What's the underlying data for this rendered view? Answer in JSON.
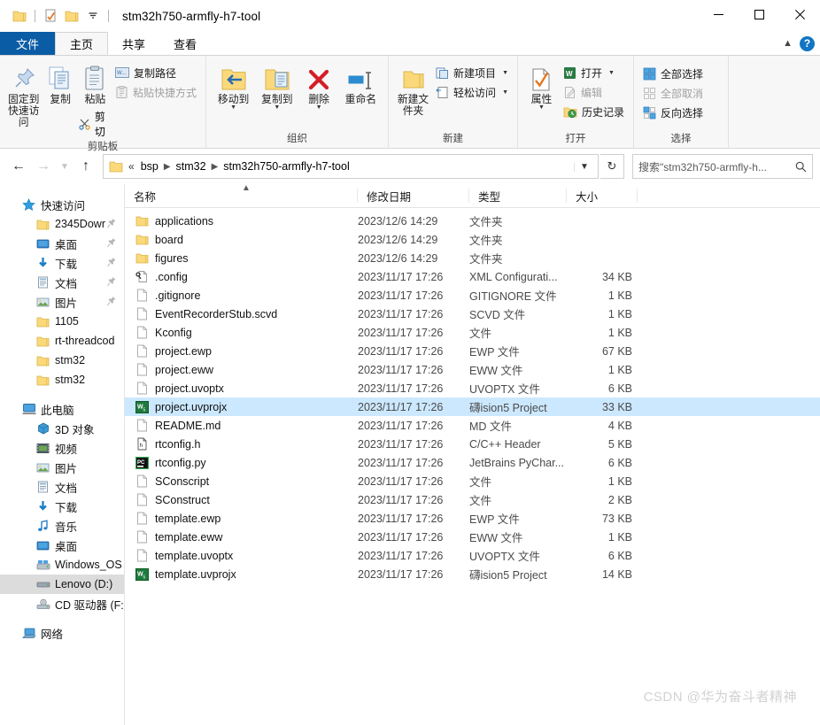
{
  "window": {
    "title": "stm32h750-armfly-h7-tool",
    "quick_access": [
      "folder-icon",
      "properties-checked-icon",
      "new-folder-icon",
      "dropdown-icon"
    ],
    "controls": {
      "minimize": "—",
      "maximize": "□",
      "close": "✕"
    }
  },
  "ribbon": {
    "tabs": [
      {
        "label": "文件",
        "type": "file"
      },
      {
        "label": "主页",
        "type": "active"
      },
      {
        "label": "共享",
        "type": "normal"
      },
      {
        "label": "查看",
        "type": "normal"
      }
    ],
    "collapse_icon": "chevron-up-icon",
    "help_icon": "?",
    "groups": [
      {
        "title": "剪贴板",
        "big": [
          {
            "label": "固定到快速访问",
            "icon": "pin-icon",
            "disabled": false
          },
          {
            "label": "复制",
            "icon": "copy-icon",
            "disabled": false
          },
          {
            "label": "粘贴",
            "icon": "paste-icon",
            "disabled": false
          }
        ],
        "small": [
          {
            "label": "复制路径",
            "icon": "copy-path-icon",
            "disabled": false
          },
          {
            "label": "粘贴快捷方式",
            "icon": "paste-shortcut-icon",
            "disabled": true
          }
        ],
        "extra_small": [
          {
            "label": "剪切",
            "icon": "scissors-icon",
            "disabled": false
          }
        ]
      },
      {
        "title": "组织",
        "big": [
          {
            "label": "移动到",
            "icon": "move-to-icon",
            "caret": true
          },
          {
            "label": "复制到",
            "icon": "copy-to-icon",
            "caret": true
          },
          {
            "label": "删除",
            "icon": "delete-icon",
            "caret": true
          },
          {
            "label": "重命名",
            "icon": "rename-icon",
            "caret": false
          }
        ]
      },
      {
        "title": "新建",
        "big": [
          {
            "label": "新建文件夹",
            "icon": "new-folder-icon"
          }
        ],
        "small": [
          {
            "label": "新建项目",
            "icon": "new-item-icon",
            "caret": true
          },
          {
            "label": "轻松访问",
            "icon": "easy-access-icon",
            "caret": true
          }
        ]
      },
      {
        "title": "打开",
        "big": [
          {
            "label": "属性",
            "icon": "properties-icon",
            "caret": true
          }
        ],
        "small": [
          {
            "label": "打开",
            "icon": "open-icon",
            "caret": true,
            "disabled": false
          },
          {
            "label": "编辑",
            "icon": "edit-icon",
            "disabled": true
          },
          {
            "label": "历史记录",
            "icon": "history-icon",
            "disabled": false
          }
        ]
      },
      {
        "title": "选择",
        "small": [
          {
            "label": "全部选择",
            "icon": "select-all-icon",
            "disabled": false
          },
          {
            "label": "全部取消",
            "icon": "select-none-icon",
            "disabled": true
          },
          {
            "label": "反向选择",
            "icon": "invert-selection-icon",
            "disabled": false
          }
        ]
      }
    ]
  },
  "address": {
    "back_icon": "back-arrow-icon",
    "forward_icon": "forward-arrow-icon",
    "recent_icon": "chevron-down-icon",
    "up_icon": "up-arrow-icon",
    "breadcrumb": [
      "«",
      "bsp",
      "stm32",
      "stm32h750-armfly-h7-tool"
    ],
    "refresh_icon": "refresh-icon",
    "search_placeholder": "搜索\"stm32h750-armfly-h...",
    "search_icon": "search-icon"
  },
  "navpane": {
    "sections": [
      {
        "root": {
          "label": "快速访问",
          "icon": "star-icon"
        },
        "items": [
          {
            "label": "2345Dowr",
            "icon": "folder-icon",
            "pinned": true
          },
          {
            "label": "桌面",
            "icon": "desktop-icon",
            "pinned": true
          },
          {
            "label": "下载",
            "icon": "download-icon",
            "pinned": true
          },
          {
            "label": "文档",
            "icon": "documents-icon",
            "pinned": true
          },
          {
            "label": "图片",
            "icon": "pictures-icon",
            "pinned": true
          },
          {
            "label": "1105",
            "icon": "folder-icon",
            "pinned": false
          },
          {
            "label": "rt-threadcod",
            "icon": "folder-icon",
            "pinned": false
          },
          {
            "label": "stm32",
            "icon": "folder-icon",
            "pinned": false
          },
          {
            "label": "stm32",
            "icon": "folder-icon",
            "pinned": false
          }
        ]
      },
      {
        "root": {
          "label": "此电脑",
          "icon": "computer-icon"
        },
        "items": [
          {
            "label": "3D 对象",
            "icon": "3d-objects-icon"
          },
          {
            "label": "视频",
            "icon": "videos-icon"
          },
          {
            "label": "图片",
            "icon": "pictures-icon"
          },
          {
            "label": "文档",
            "icon": "documents-icon"
          },
          {
            "label": "下载",
            "icon": "download-icon"
          },
          {
            "label": "音乐",
            "icon": "music-icon"
          },
          {
            "label": "桌面",
            "icon": "desktop-icon"
          },
          {
            "label": "Windows_OS",
            "icon": "drive-icon"
          },
          {
            "label": "Lenovo (D:)",
            "icon": "drive-icon",
            "selected": true
          },
          {
            "label": "CD 驱动器 (F:",
            "icon": "cd-drive-icon"
          }
        ]
      },
      {
        "root": {
          "label": "网络",
          "icon": "network-icon"
        },
        "items": []
      }
    ]
  },
  "filelist": {
    "columns": [
      {
        "label": "名称",
        "key": "name",
        "sorted": "asc"
      },
      {
        "label": "修改日期",
        "key": "date"
      },
      {
        "label": "类型",
        "key": "type"
      },
      {
        "label": "大小",
        "key": "size"
      }
    ],
    "rows": [
      {
        "name": "applications",
        "date": "2023/12/6 14:29",
        "type": "文件夹",
        "size": "",
        "icon": "folder-icon",
        "selected": false
      },
      {
        "name": "board",
        "date": "2023/12/6 14:29",
        "type": "文件夹",
        "size": "",
        "icon": "folder-icon",
        "selected": false
      },
      {
        "name": "figures",
        "date": "2023/12/6 14:29",
        "type": "文件夹",
        "size": "",
        "icon": "folder-icon",
        "selected": false
      },
      {
        "name": ".config",
        "date": "2023/11/17 17:26",
        "type": "XML Configurati...",
        "size": "34 KB",
        "icon": "config-file-icon",
        "selected": false
      },
      {
        "name": ".gitignore",
        "date": "2023/11/17 17:26",
        "type": "GITIGNORE 文件",
        "size": "1 KB",
        "icon": "blank-file-icon",
        "selected": false
      },
      {
        "name": "EventRecorderStub.scvd",
        "date": "2023/11/17 17:26",
        "type": "SCVD 文件",
        "size": "1 KB",
        "icon": "blank-file-icon",
        "selected": false
      },
      {
        "name": "Kconfig",
        "date": "2023/11/17 17:26",
        "type": "文件",
        "size": "1 KB",
        "icon": "blank-file-icon",
        "selected": false
      },
      {
        "name": "project.ewp",
        "date": "2023/11/17 17:26",
        "type": "EWP 文件",
        "size": "67 KB",
        "icon": "blank-file-icon",
        "selected": false
      },
      {
        "name": "project.eww",
        "date": "2023/11/17 17:26",
        "type": "EWW 文件",
        "size": "1 KB",
        "icon": "blank-file-icon",
        "selected": false
      },
      {
        "name": "project.uvoptx",
        "date": "2023/11/17 17:26",
        "type": "UVOPTX 文件",
        "size": "6 KB",
        "icon": "blank-file-icon",
        "selected": false
      },
      {
        "name": "project.uvprojx",
        "date": "2023/11/17 17:26",
        "type": "礴ision5 Project",
        "size": "33 KB",
        "icon": "keil-icon",
        "selected": true
      },
      {
        "name": "README.md",
        "date": "2023/11/17 17:26",
        "type": "MD 文件",
        "size": "4 KB",
        "icon": "blank-file-icon",
        "selected": false
      },
      {
        "name": "rtconfig.h",
        "date": "2023/11/17 17:26",
        "type": "C/C++ Header",
        "size": "5 KB",
        "icon": "header-file-icon",
        "selected": false
      },
      {
        "name": "rtconfig.py",
        "date": "2023/11/17 17:26",
        "type": "JetBrains PyChar...",
        "size": "6 KB",
        "icon": "pycharm-icon",
        "selected": false
      },
      {
        "name": "SConscript",
        "date": "2023/11/17 17:26",
        "type": "文件",
        "size": "1 KB",
        "icon": "blank-file-icon",
        "selected": false
      },
      {
        "name": "SConstruct",
        "date": "2023/11/17 17:26",
        "type": "文件",
        "size": "2 KB",
        "icon": "blank-file-icon",
        "selected": false
      },
      {
        "name": "template.ewp",
        "date": "2023/11/17 17:26",
        "type": "EWP 文件",
        "size": "73 KB",
        "icon": "blank-file-icon",
        "selected": false
      },
      {
        "name": "template.eww",
        "date": "2023/11/17 17:26",
        "type": "EWW 文件",
        "size": "1 KB",
        "icon": "blank-file-icon",
        "selected": false
      },
      {
        "name": "template.uvoptx",
        "date": "2023/11/17 17:26",
        "type": "UVOPTX 文件",
        "size": "6 KB",
        "icon": "blank-file-icon",
        "selected": false
      },
      {
        "name": "template.uvprojx",
        "date": "2023/11/17 17:26",
        "type": "礴ision5 Project",
        "size": "14 KB",
        "icon": "keil-icon",
        "selected": false
      }
    ]
  },
  "watermark": "CSDN @华为奋斗者精神",
  "colors": {
    "file_tab": "#0a5ca5",
    "selection": "#cce8ff",
    "nav_selection": "#dcdcdc",
    "folder": "#fbd97a",
    "accent": "#1175c4"
  }
}
